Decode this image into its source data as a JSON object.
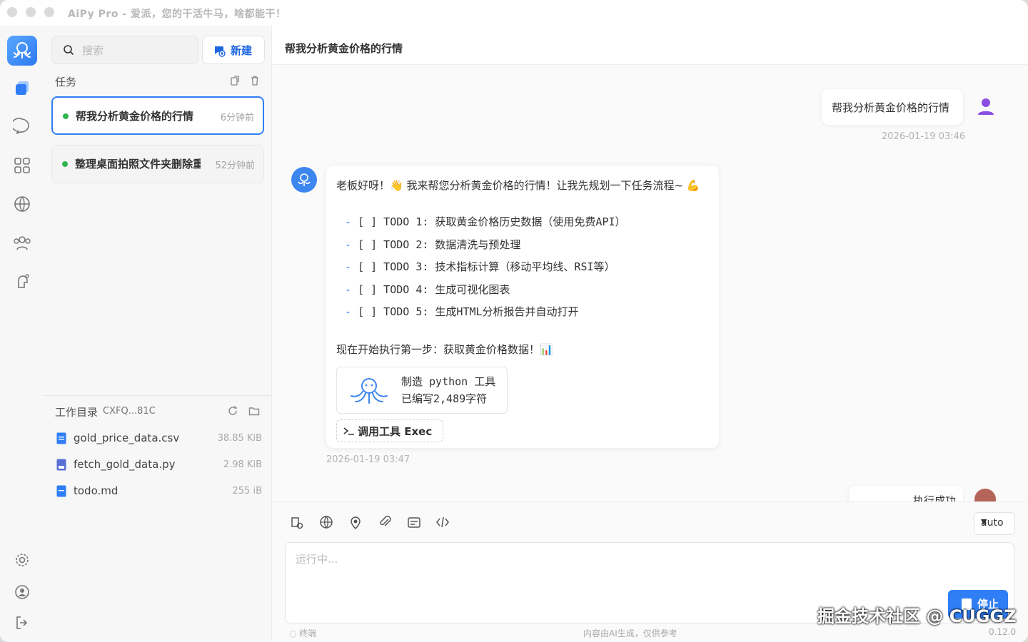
{
  "window": {
    "title": "AiPy Pro - 爱派，您的干活牛马，啥都能干！"
  },
  "tasks_panel": {
    "search_placeholder": "搜索",
    "new_label": "新建",
    "section_label": "任务",
    "items": [
      {
        "title": "帮我分析黄金价格的行情",
        "time": "6分钟前",
        "status": "running",
        "active": true
      },
      {
        "title": "整理桌面拍照文件夹删除重复",
        "time": "52分钟前",
        "status": "running",
        "active": false
      }
    ],
    "workdir": {
      "label": "工作目录",
      "id": "CXFQ...81C",
      "files": [
        {
          "name": "gold_price_data.csv",
          "size": "38.85 KiB",
          "icon": "csv-file-icon"
        },
        {
          "name": "fetch_gold_data.py",
          "size": "2.98 KiB",
          "icon": "python-file-icon"
        },
        {
          "name": "todo.md",
          "size": "255 iB",
          "icon": "markdown-file-icon"
        }
      ]
    }
  },
  "chat": {
    "header_title": "帮我分析黄金价格的行情",
    "user_message": {
      "text": "帮我分析黄金价格的行情",
      "time": "2026-01-19 03:46"
    },
    "bot_message": {
      "intro": "老板好呀！👋 我来帮您分析黄金价格的行情！让我先规划一下任务流程~ 💪",
      "todos": [
        "[ ] TODO 1: 获取黄金价格历史数据（使用免费API）",
        "[ ] TODO 2: 数据清洗与预处理",
        "[ ] TODO 3: 技术指标计算（移动平均线、RSI等）",
        "[ ] TODO 4: 生成可视化图表",
        "[ ] TODO 5: 生成HTML分析报告并自动打开"
      ],
      "exec_line": "现在开始执行第一步：获取黄金价格数据！📊",
      "tool_card": {
        "line1": "制造 python 工具",
        "line2": "已编写2,489字符"
      },
      "tool_call": "调用工具 Exec",
      "time": "2026-01-19 03:47"
    },
    "next_message_partial": "执行成功"
  },
  "input": {
    "placeholder": "运行中...",
    "model_select": "auto",
    "stop_label": "停止",
    "terminal_label": "终端",
    "disclaimer": "内容由AI生成，仅供参考",
    "version": "0.12.0"
  },
  "watermark": "掘金技术社区 @ CUGGZ",
  "colors": {
    "accent": "#2f7ef5",
    "status_green": "#2fb54e"
  }
}
